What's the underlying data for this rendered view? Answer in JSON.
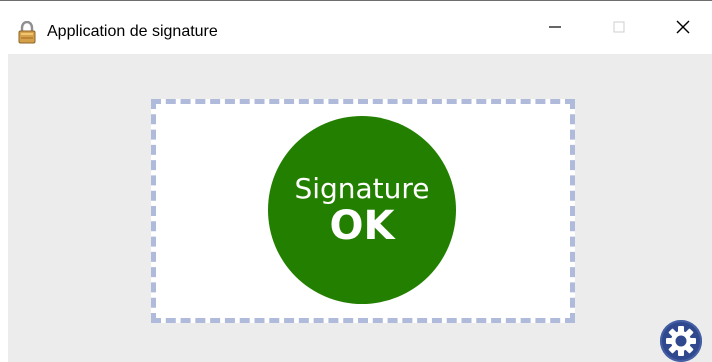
{
  "window": {
    "title": "Application de signature",
    "icon": "lock-icon",
    "controls": {
      "minimize_icon": "minimize-icon",
      "maximize_icon": "maximize-icon",
      "close_icon": "close-icon"
    }
  },
  "main": {
    "signature_status": {
      "label": "Signature",
      "value": "OK",
      "color": "#237f00"
    },
    "frame_color": "#b0bbdc",
    "background_color": "#ececec",
    "settings_icon": "gear-icon",
    "settings_color": "#30488e"
  }
}
